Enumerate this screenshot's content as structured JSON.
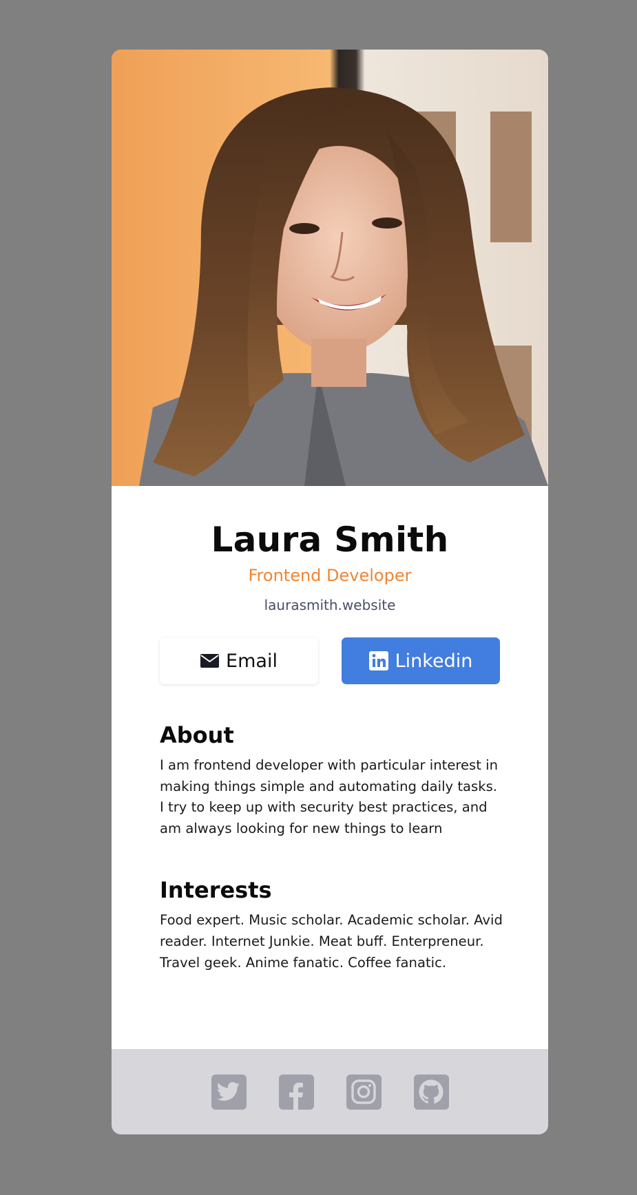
{
  "profile": {
    "name": "Laura Smith",
    "role": "Frontend Developer",
    "website": "laurasmith.website",
    "photo_alt": "Laura Smith"
  },
  "buttons": {
    "email_label": "Email",
    "linkedin_label": "Linkedin"
  },
  "about": {
    "title": "About",
    "text": "I am frontend developer with particular interest in making things simple and automating daily tasks. I try to keep up with security best practices, and am always looking for new things to learn"
  },
  "interests": {
    "title": "Interests",
    "text": "Food expert. Music scholar. Academic scholar. Avid reader. Internet Junkie. Meat buff. Enterpreneur. Travel geek. Anime fanatic. Coffee fanatic."
  },
  "footer": {
    "icons": [
      "twitter-icon",
      "facebook-icon",
      "instagram-icon",
      "github-icon"
    ]
  },
  "colors": {
    "background": "#808080",
    "card": "#ffffff",
    "accent_orange": "#ee8535",
    "linkedin_blue": "#427de0",
    "footer_bg": "#d6d6db",
    "social_icon": "#a0a0ab"
  }
}
